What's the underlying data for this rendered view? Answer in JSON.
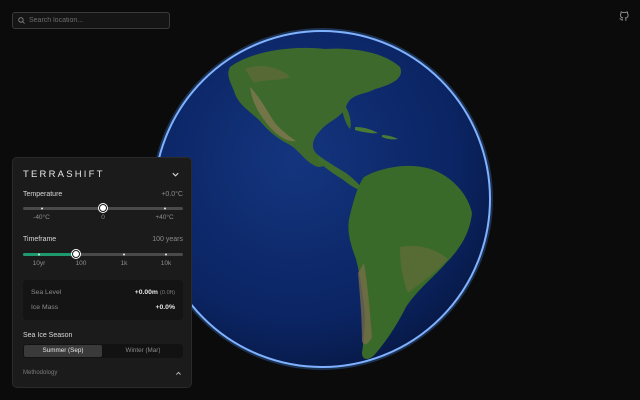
{
  "search": {
    "placeholder": "Search location..."
  },
  "icons": {
    "search": "search-icon",
    "github": "github-icon",
    "collapse": "chevron-down-icon",
    "methodology": "chevron-up-icon"
  },
  "panel": {
    "title": "TERRASHIFT",
    "temperature": {
      "label": "Temperature",
      "value": "+0.0°C",
      "ticks": [
        "-40°C",
        "0",
        "+40°C"
      ],
      "level": 0.5
    },
    "timeframe": {
      "label": "Timeframe",
      "value": "100 years",
      "ticks": [
        "10yr",
        "100",
        "1k",
        "10k"
      ],
      "level": 0.3333
    },
    "stats": {
      "sea_level_label": "Sea Level",
      "sea_level_value": "+0.00m",
      "sea_level_sub": "(0.0ft)",
      "ice_mass_label": "Ice Mass",
      "ice_mass_value": "+0.0%"
    },
    "season": {
      "label": "Sea Ice Season",
      "options": [
        "Summer (Sep)",
        "Winter (Mar)"
      ],
      "selected": "Summer (Sep)"
    },
    "methodology_label": "Methodology"
  },
  "colors": {
    "accent": "#1f9a6e",
    "globe_rim": "#6aa8ff",
    "ocean": "#0d2a6e",
    "land": "#3f6a2a"
  }
}
